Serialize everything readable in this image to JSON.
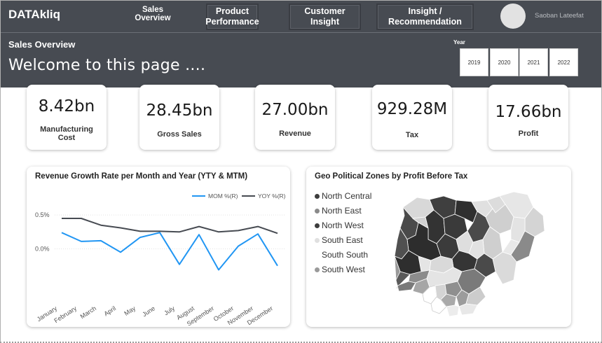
{
  "brand": "DATAkliq",
  "nav": {
    "sales_overview": "Sales\nOverview",
    "product_performance": "Product\nPerformance",
    "customer_insight": "Customer\nInsight",
    "insight_recommendation": "Insight /\nRecommendation"
  },
  "user": {
    "name": "Saoban Lateefat"
  },
  "header": {
    "page_title": "Sales Overview",
    "welcome": "Welcome to this page ....",
    "year_label": "Year",
    "years": [
      "2019",
      "2020",
      "2021",
      "2022"
    ]
  },
  "kpis": [
    {
      "value": "8.42bn",
      "label": "Manufacturing Cost"
    },
    {
      "value": "28.45bn",
      "label": "Gross Sales"
    },
    {
      "value": "27.00bn",
      "label": "Revenue"
    },
    {
      "value": "929.28M",
      "label": "Tax"
    },
    {
      "value": "17.66bn",
      "label": "Profit"
    }
  ],
  "growth_panel": {
    "title": "Revenue Growth Rate per Month and Year (YTY & MTM)"
  },
  "chart_data": {
    "type": "line",
    "title": "Revenue Growth Rate per Month and Year (YTY & MTM)",
    "categories": [
      "January",
      "February",
      "March",
      "April",
      "May",
      "June",
      "July",
      "August",
      "September",
      "October",
      "November",
      "December"
    ],
    "yticks": [
      "0.5%",
      "0.0%"
    ],
    "ytick_values": [
      0.5,
      0.0
    ],
    "ylim": [
      -0.75,
      0.75
    ],
    "grid": true,
    "legend": "top-right",
    "series": [
      {
        "name": "MOM %(R)",
        "color": "#2196f3",
        "values": [
          0.24,
          0.11,
          0.12,
          -0.05,
          0.17,
          0.24,
          -0.23,
          0.21,
          -0.31,
          0.04,
          0.22,
          -0.25
        ]
      },
      {
        "name": "YOY %(R)",
        "color": "#474b52",
        "values": [
          0.45,
          0.45,
          0.35,
          0.31,
          0.26,
          0.26,
          0.25,
          0.33,
          0.25,
          0.27,
          0.33,
          0.23
        ]
      }
    ]
  },
  "geo_panel": {
    "title": "Geo Political Zones by Profit Before Tax",
    "zones": [
      {
        "name": "North Central",
        "color": "#3d3d3d"
      },
      {
        "name": "North East",
        "color": "#8a8a8a"
      },
      {
        "name": "North West",
        "color": "#3d3d3d"
      },
      {
        "name": "South East",
        "color": "#e0e0e0"
      },
      {
        "name": "South South",
        "color": "#ffffff"
      },
      {
        "name": "South West",
        "color": "#9a9a9a"
      }
    ]
  }
}
